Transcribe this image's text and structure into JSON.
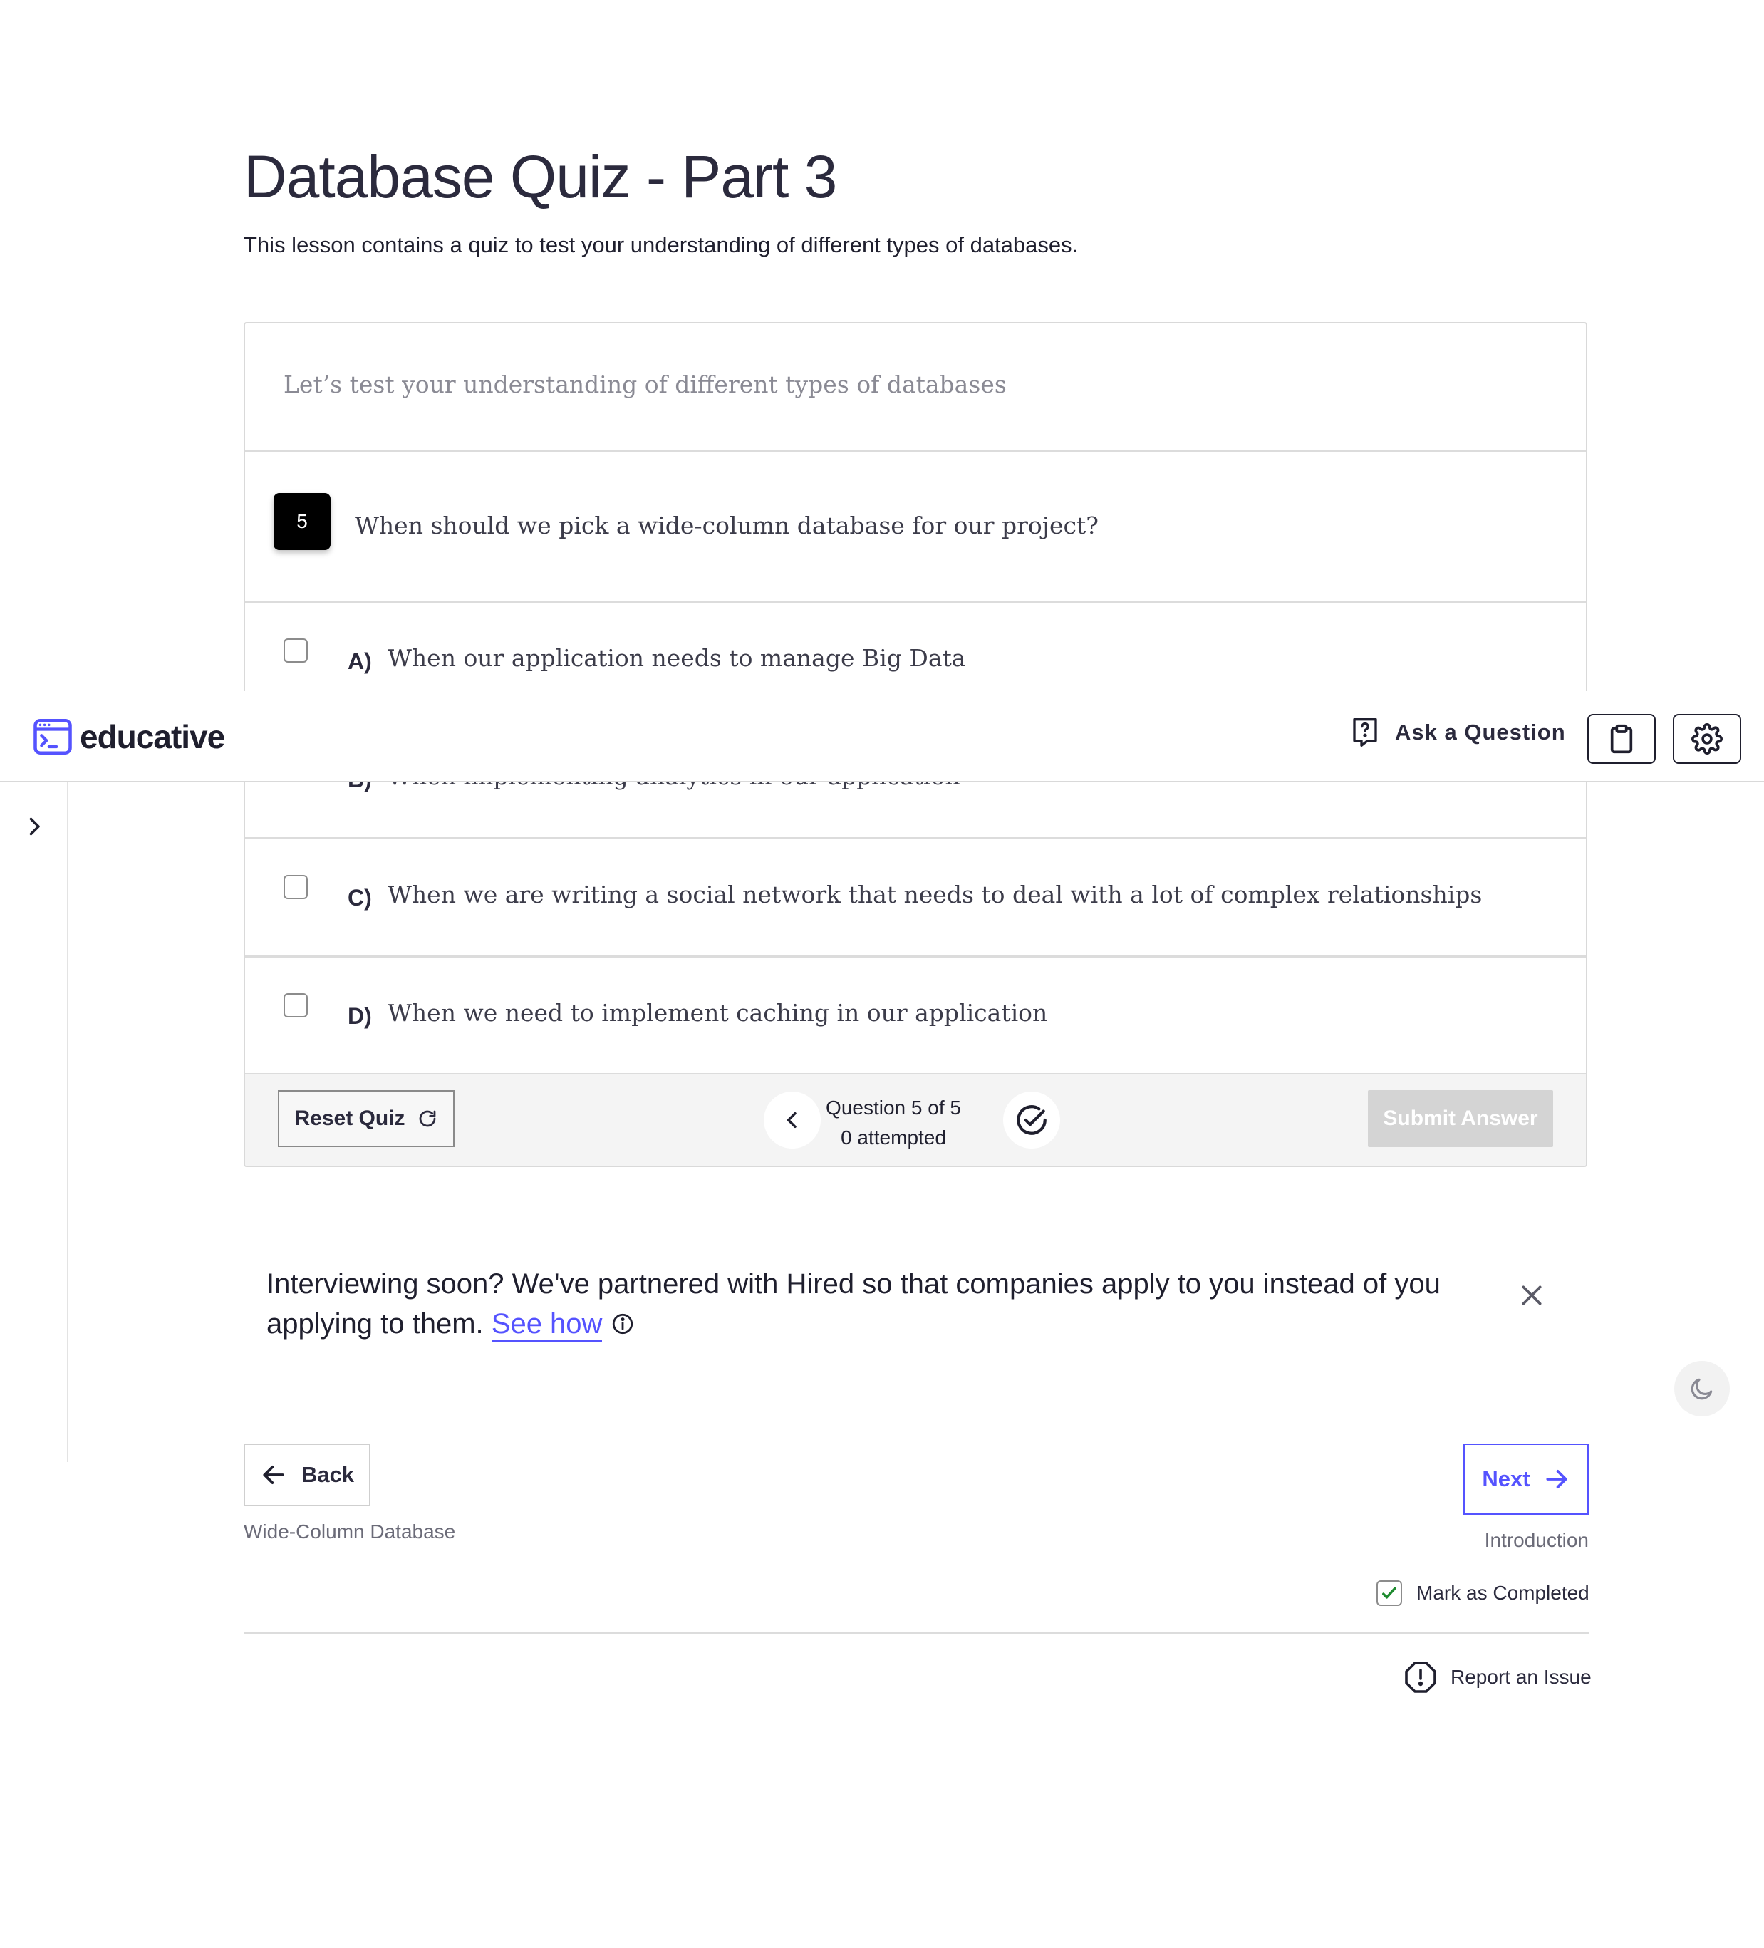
{
  "lesson": {
    "title": "Database Quiz - Part 3",
    "subtitle": "This lesson contains a quiz to test your understanding of different types of databases."
  },
  "quiz": {
    "intro": "Let’s test your understanding of different types of databases",
    "question_number": "5",
    "question_text": "When should we pick a wide-column database for our project?",
    "options": [
      {
        "letter": "A)",
        "text": "When our application needs to manage Big Data"
      },
      {
        "letter": "B)",
        "text": "When implementing analytics in our application"
      },
      {
        "letter": "C)",
        "text": "When we are writing a social network that needs to deal with a lot of complex relationships"
      },
      {
        "letter": "D)",
        "text": "When we need to implement caching in our application"
      }
    ],
    "reset_label": "Reset Quiz",
    "status_line1": "Question 5 of 5",
    "status_line2": "0 attempted",
    "submit_label": "Submit Answer"
  },
  "nav": {
    "brand": "educative",
    "ask_question": "Ask a Question",
    "accent": "#5553ff"
  },
  "banner": {
    "text": "Interviewing soon? We've partnered with Hired so that companies apply to you instead of you applying to them.",
    "link": "See how"
  },
  "footer": {
    "back_label": "Back",
    "back_lesson": "Wide-Column Database",
    "next_label": "Next",
    "next_lesson": "Introduction",
    "mark_completed": "Mark as Completed",
    "report_issue": "Report an Issue"
  }
}
